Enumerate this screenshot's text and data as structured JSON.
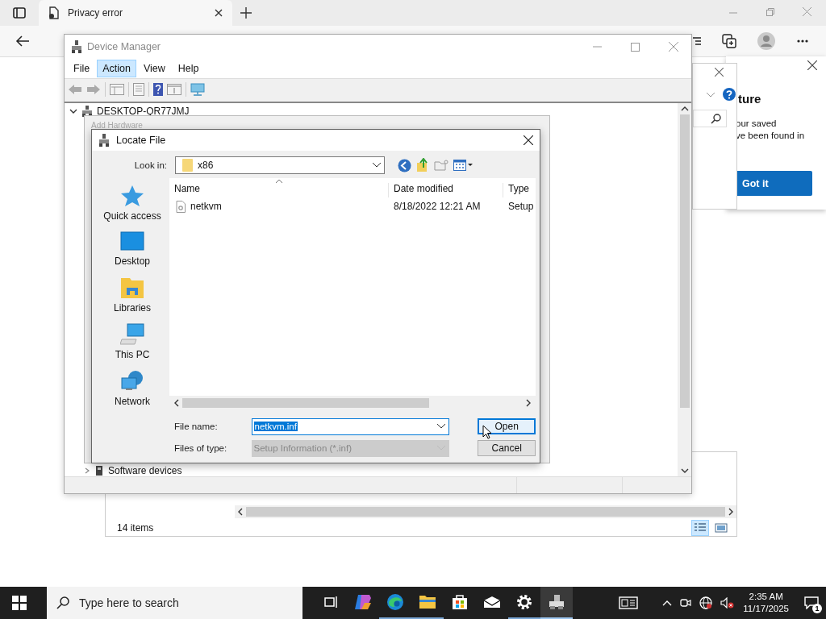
{
  "browser": {
    "tab": {
      "title": "Privacy error"
    }
  },
  "side_popup": {
    "heading": "ture",
    "body_lines": [
      "our saved",
      "ve been found in"
    ],
    "button": "Got it"
  },
  "explorer": {
    "status": "14 items",
    "views": [
      {
        "kind": "details",
        "selected": true
      },
      {
        "kind": "preview",
        "selected": false
      }
    ]
  },
  "device_manager": {
    "title": "Device Manager",
    "menu": [
      {
        "label": "File",
        "selected": false
      },
      {
        "label": "Action",
        "selected": true
      },
      {
        "label": "View",
        "selected": false
      },
      {
        "label": "Help",
        "selected": false
      }
    ],
    "tree": {
      "label": "DESKTOP-QR77JMJ",
      "expanded": true,
      "children": [
        {
          "label": "Software devices",
          "expanded": false
        }
      ]
    }
  },
  "add_hardware": {
    "title": "Add Hardware"
  },
  "locate_file": {
    "title": "Locate File",
    "look_in_label": "Look in:",
    "look_in_value": "x86",
    "places": [
      {
        "label": "Quick access",
        "kind": "star"
      },
      {
        "label": "Desktop",
        "kind": "desktop"
      },
      {
        "label": "Libraries",
        "kind": "libraries"
      },
      {
        "label": "This PC",
        "kind": "pc"
      },
      {
        "label": "Network",
        "kind": "network"
      }
    ],
    "columns": [
      "Name",
      "Date modified",
      "Type"
    ],
    "rows": [
      {
        "name": "netkvm",
        "date": "8/18/2022 12:21 AM",
        "type": "Setup"
      }
    ],
    "file_name_label": "File name:",
    "file_name_value": "netkvm.inf",
    "file_type_label": "Files of type:",
    "file_type_value": "Setup Information (*.inf)",
    "file_type_disabled": true,
    "buttons": [
      {
        "label": "Open",
        "default": true
      },
      {
        "label": "Cancel",
        "default": false
      }
    ]
  },
  "taskbar": {
    "search_placeholder": "Type here to search",
    "apps": [
      {
        "kind": "taskview",
        "running": false,
        "active": false
      },
      {
        "kind": "copilot",
        "running": false,
        "active": false
      },
      {
        "kind": "edge",
        "running": true,
        "active": false
      },
      {
        "kind": "folder",
        "running": true,
        "active": false
      },
      {
        "kind": "store",
        "running": false,
        "active": false
      },
      {
        "kind": "mail",
        "running": false,
        "active": false
      },
      {
        "kind": "settings",
        "running": true,
        "active": false
      },
      {
        "kind": "devmgr",
        "running": true,
        "active": true
      }
    ],
    "time": "2:35 AM",
    "date": "11/17/2025",
    "notification_count": "1"
  }
}
